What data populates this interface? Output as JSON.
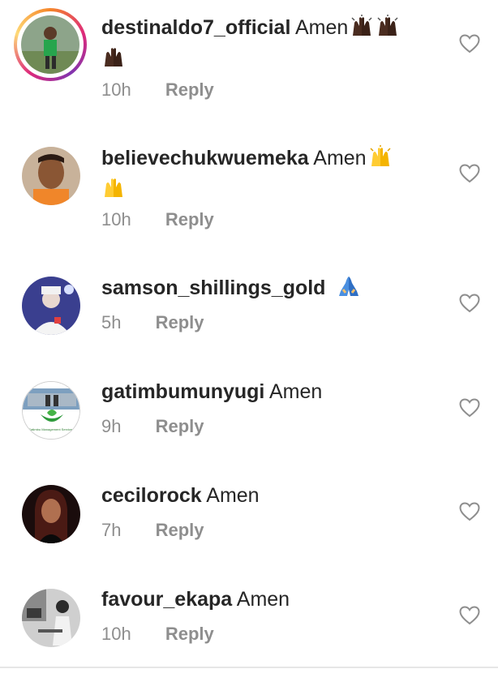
{
  "comments": [
    {
      "username": "destinaldo7_official",
      "text": "Amen",
      "emoji": [
        "raising-hands-dark",
        "raising-hands-dark",
        "raising-hands-dark"
      ],
      "time": "10h",
      "reply": "Reply",
      "has_story": true
    },
    {
      "username": "believechukwuemeka",
      "text": "Amen",
      "emoji": [
        "raising-hands-yellow",
        "raising-hands-yellow"
      ],
      "time": "10h",
      "reply": "Reply",
      "has_story": false
    },
    {
      "username": "samson_shillings_gold",
      "text": "",
      "emoji": [
        "folded-hands"
      ],
      "time": "5h",
      "reply": "Reply",
      "has_story": false
    },
    {
      "username": "gatimbumunyugi",
      "text": "Amen",
      "emoji": [],
      "time": "9h",
      "reply": "Reply",
      "has_story": false,
      "avatar_caption": "Gatimbu Management Services"
    },
    {
      "username": "cecilorock",
      "text": "Amen",
      "emoji": [],
      "time": "7h",
      "reply": "Reply",
      "has_story": false
    },
    {
      "username": "favour_ekapa",
      "text": "Amen",
      "emoji": [],
      "time": "10h",
      "reply": "Reply",
      "has_story": false
    }
  ],
  "icons": {
    "like": "heart-outline-icon"
  },
  "colors": {
    "username": "#262626",
    "meta": "#8e8e8e",
    "heart": "#8e8e8e",
    "story_ring": [
      "#f58529",
      "#dd2a7b",
      "#8134af"
    ]
  }
}
